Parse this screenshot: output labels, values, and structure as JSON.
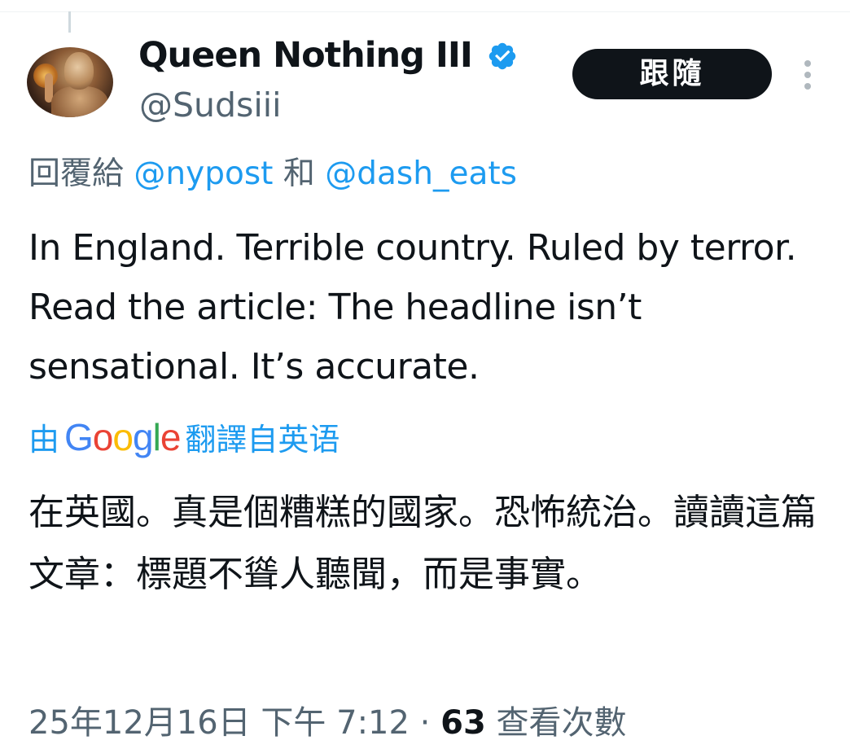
{
  "tweet": {
    "author": {
      "display_name": "Queen Nothing III",
      "handle": "@Sudsiii",
      "verified": true,
      "verified_color": "#1d9bf0",
      "avatar_icon": "avatar-photo"
    },
    "follow_button_label": "跟隨",
    "more_icon": "more-vertical-icon",
    "reply": {
      "prefix": "回覆給",
      "mention_1": "@nypost",
      "conjunction": "和",
      "mention_2": "@dash_eats"
    },
    "text": "In England. Terrible country. Ruled by terror. Read the article: The headline isn’t sensational. It’s accurate.",
    "translation": {
      "prefix": "由",
      "provider": "Google",
      "suffix": "翻譯自英语",
      "text": "在英國。真是個糟糕的國家。恐怖統治。讀讀這篇文章：標題不聳人聽聞，而是事實。"
    },
    "meta": {
      "timestamp": "25年12月16日 下午 7:12",
      "separator": "·",
      "views_count": "63",
      "views_label": "查看次數"
    }
  },
  "colors": {
    "text_primary": "#0f1419",
    "text_secondary": "#536471",
    "link": "#1d9bf0",
    "follow_bg": "#0f1419",
    "follow_text": "#ffffff"
  }
}
